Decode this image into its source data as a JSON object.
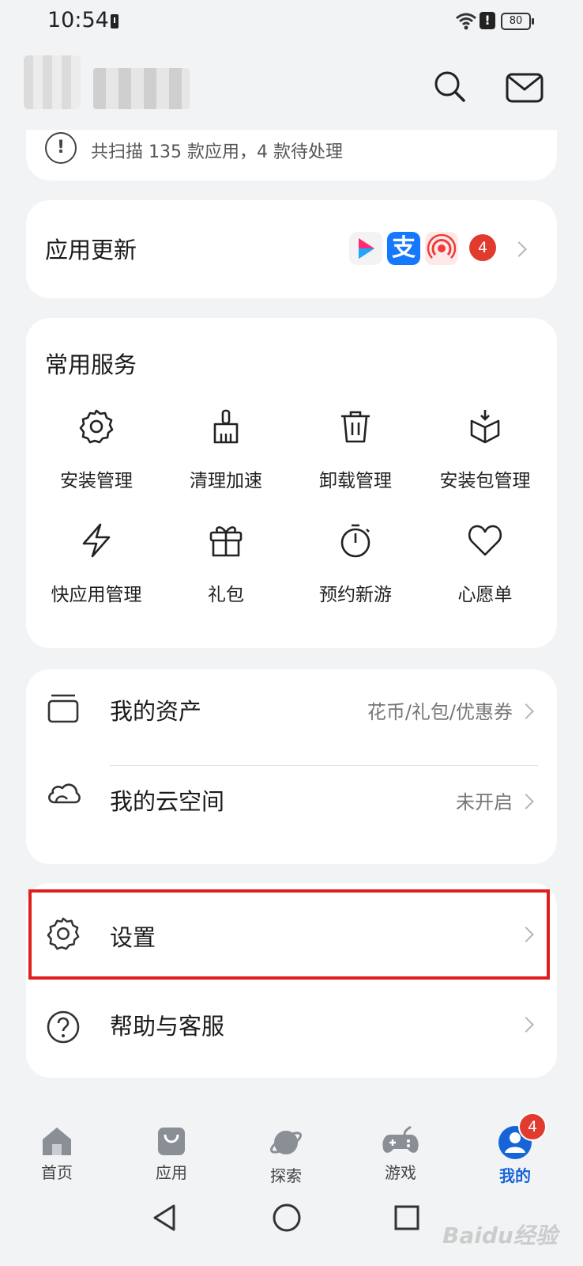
{
  "status_bar": {
    "time": "10:54",
    "warn": "!",
    "battery": "80"
  },
  "header": {
    "search_icon": "search-icon",
    "mail_icon": "mail-icon"
  },
  "scan_notice": {
    "icon": "!",
    "text": "共扫描 135 款应用，4 款待处理"
  },
  "app_update": {
    "title": "应用更新",
    "apps": [
      {
        "icon": "video-app-icon",
        "color": "#ff2b6e"
      },
      {
        "icon": "alipay-icon",
        "color": "#1677ff",
        "glyph": "支"
      },
      {
        "icon": "podcast-icon",
        "color": "#ef3b3b"
      }
    ],
    "badge": "4"
  },
  "services": {
    "title": "常用服务",
    "items": [
      {
        "label": "安装管理",
        "icon": "gear-icon"
      },
      {
        "label": "清理加速",
        "icon": "broom-icon"
      },
      {
        "label": "卸载管理",
        "icon": "trash-icon"
      },
      {
        "label": "安装包管理",
        "icon": "package-icon"
      },
      {
        "label": "快应用管理",
        "icon": "quick-app-icon"
      },
      {
        "label": "礼包",
        "icon": "gift-icon"
      },
      {
        "label": "预约新游",
        "icon": "timer-icon"
      },
      {
        "label": "心愿单",
        "icon": "heart-icon"
      }
    ]
  },
  "assets": {
    "items": [
      {
        "label": "我的资产",
        "value": "花币/礼包/优惠券",
        "icon": "box-icon"
      },
      {
        "label": "我的云空间",
        "value": "未开启",
        "icon": "cloud-icon"
      }
    ]
  },
  "settings_group": {
    "items": [
      {
        "label": "设置",
        "icon": "gear-icon"
      },
      {
        "label": "帮助与客服",
        "icon": "help-icon"
      }
    ]
  },
  "tabbar": {
    "tabs": [
      {
        "label": "首页",
        "icon": "home-icon"
      },
      {
        "label": "应用",
        "icon": "bag-icon"
      },
      {
        "label": "探索",
        "icon": "planet-icon"
      },
      {
        "label": "游戏",
        "icon": "gamepad-icon"
      },
      {
        "label": "我的",
        "icon": "profile-icon",
        "active": true,
        "badge": "4"
      }
    ],
    "accent": "#1565d8"
  },
  "watermark": "Baidu经验"
}
